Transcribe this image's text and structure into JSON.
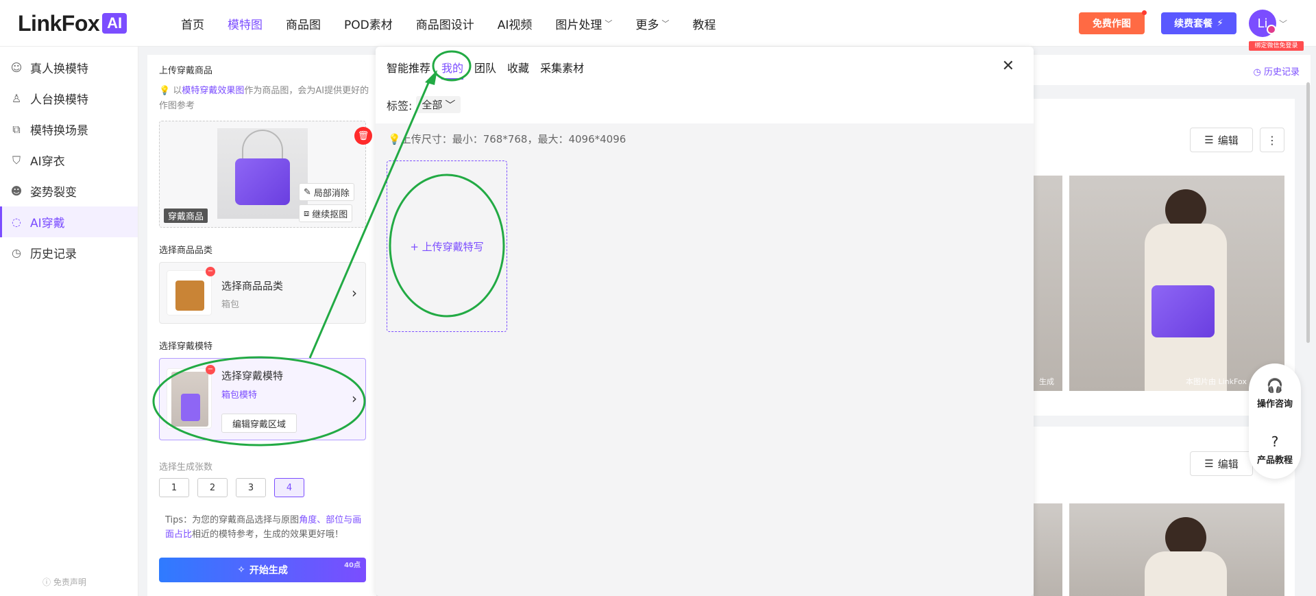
{
  "brand": {
    "name": "LinkFox",
    "badge": "AI"
  },
  "nav": {
    "items": [
      {
        "label": "首页",
        "active": false,
        "dropdown": false
      },
      {
        "label": "模特图",
        "active": true,
        "dropdown": false
      },
      {
        "label": "商品图",
        "active": false,
        "dropdown": false
      },
      {
        "label": "POD素材",
        "active": false,
        "dropdown": false
      },
      {
        "label": "商品图设计",
        "active": false,
        "dropdown": false
      },
      {
        "label": "AI视频",
        "active": false,
        "dropdown": false
      },
      {
        "label": "图片处理",
        "active": false,
        "dropdown": true
      },
      {
        "label": "更多",
        "active": false,
        "dropdown": true
      },
      {
        "label": "教程",
        "active": false,
        "dropdown": false
      }
    ],
    "free_btn": "免费作图",
    "renew_btn": "续费套餐",
    "avatar_text": "Li",
    "wechat_tip": "绑定微信免登录"
  },
  "sidebar": {
    "items": [
      {
        "label": "真人换模特",
        "icon": "person-swap-icon"
      },
      {
        "label": "人台换模特",
        "icon": "mannequin-icon"
      },
      {
        "label": "模特换场景",
        "icon": "scene-swap-icon"
      },
      {
        "label": "AI穿衣",
        "icon": "shirt-icon"
      },
      {
        "label": "姿势裂变",
        "icon": "pose-icon"
      },
      {
        "label": "AI穿戴",
        "icon": "accessory-icon"
      },
      {
        "label": "历史记录",
        "icon": "history-icon"
      }
    ],
    "active_index": 5,
    "disclaimer": "免责声明"
  },
  "config": {
    "upload_title": "上传穿戴商品",
    "tip_prefix": "以",
    "tip_link": "模特穿戴效果图",
    "tip_suffix": "作为商品图，会为AI提供更好的作图参考",
    "goods_tag": "穿戴商品",
    "partial_erase": "局部消除",
    "continue_cutout": "继续抠图",
    "category_label": "选择商品品类",
    "category_title": "选择商品品类",
    "category_value": "箱包",
    "model_label": "选择穿戴模特",
    "model_title": "选择穿戴模特",
    "model_value": "箱包模特",
    "edit_area": "编辑穿戴区域",
    "count_label": "选择生成张数",
    "counts": [
      "1",
      "2",
      "3",
      "4"
    ],
    "count_selected": "4",
    "tips_prefix": "Tips：为您的穿戴商品选择与原图",
    "tips_hl": "角度、部位与画面占比",
    "tips_suffix": "相近的模特参考，生成的效果更好哦！",
    "generate": "开始生成",
    "points": "40点"
  },
  "modal": {
    "tabs": [
      "智能推荐",
      "我的",
      "团队",
      "收藏",
      "采集素材"
    ],
    "active_tab": 1,
    "label_key": "标签:",
    "label_value": "全部",
    "size_tip": "上传尺寸：最小：768*768，最大：4096*4096",
    "upload_tile": "+ 上传穿戴特写"
  },
  "results": {
    "history": "历史记录",
    "edit": "编辑",
    "more": "⋮",
    "watermark": "本图片由 LinkFox",
    "watermark_left": "生成"
  },
  "float": {
    "consult": "操作咨询",
    "tutorial": "产品教程"
  },
  "colors": {
    "accent": "#7b4dff",
    "orange": "#ff6a44",
    "blue": "#5a58ff",
    "annotation": "#22aa44"
  }
}
